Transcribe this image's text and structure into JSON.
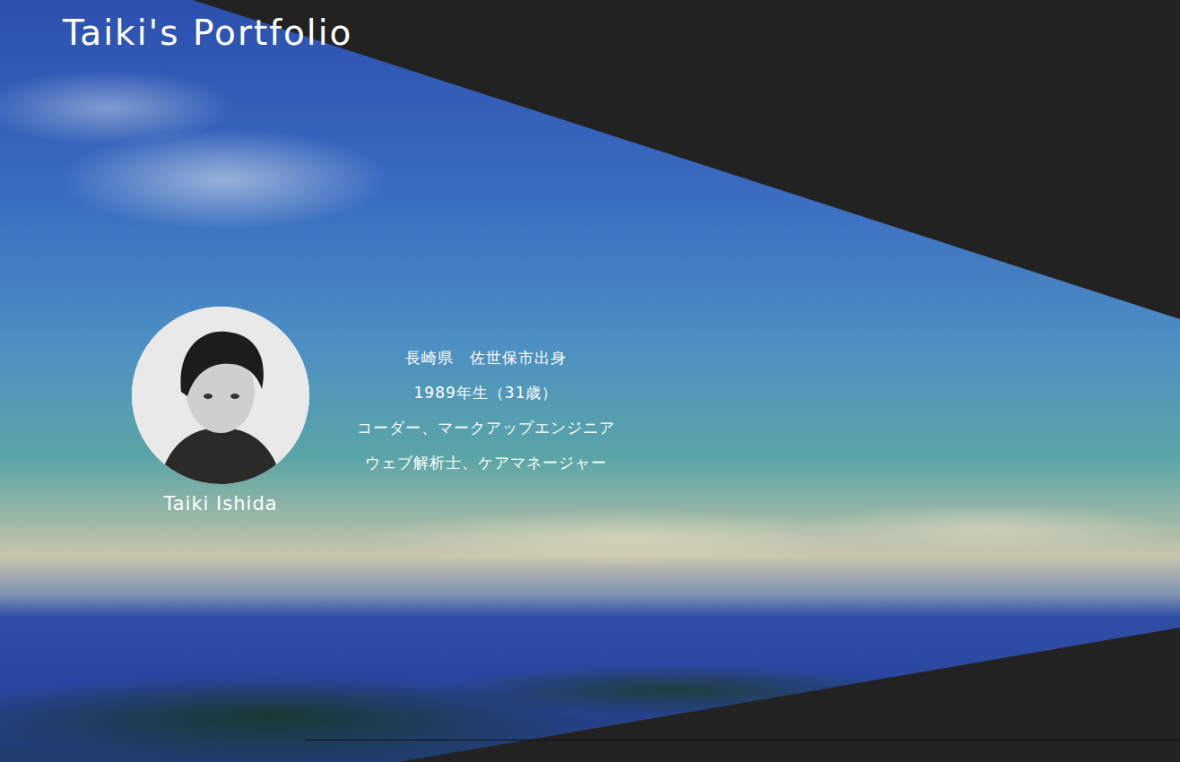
{
  "header": {
    "title": "Taiki's Portfolio"
  },
  "profile": {
    "name": "Taiki Ishida",
    "details": [
      "長崎県　佐世保市出身",
      "1989年生（31歳）",
      "コーダー、マークアップエンジニア",
      "ウェブ解析士、ケアマネージャー"
    ]
  }
}
